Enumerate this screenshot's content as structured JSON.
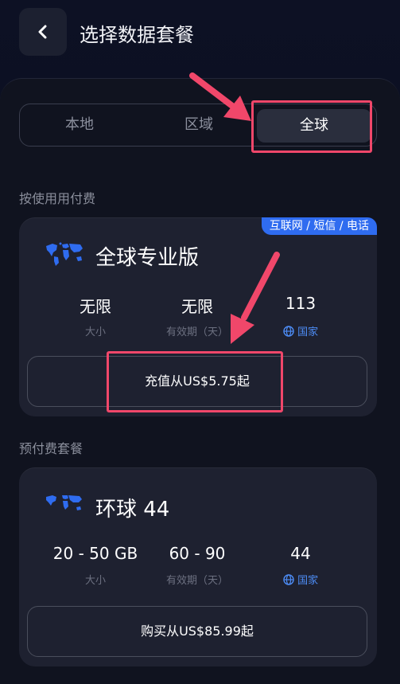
{
  "header": {
    "title": "选择数据套餐"
  },
  "tabs": [
    {
      "label": "本地",
      "active": false
    },
    {
      "label": "区域",
      "active": false
    },
    {
      "label": "全球",
      "active": true
    }
  ],
  "payg": {
    "section_label": "按使用用付费",
    "badge": "互联网 / 短信 / 电话",
    "title": "全球专业版",
    "stats": [
      {
        "value": "无限",
        "label": "大小"
      },
      {
        "value": "无限",
        "label": "有效期（天）"
      },
      {
        "value": "113",
        "label": "国家",
        "icon": "globe-icon"
      }
    ],
    "cta": "充值从US$5.75起"
  },
  "prepaid": {
    "section_label": "预付费套餐",
    "title": "环球 44",
    "stats": [
      {
        "value": "20 - 50 GB",
        "label": "大小"
      },
      {
        "value": "60 - 90",
        "label": "有效期（天）"
      },
      {
        "value": "44",
        "label": "国家",
        "icon": "globe-icon"
      }
    ],
    "cta": "购买从US$85.99起"
  },
  "colors": {
    "accent": "#2f6cf0",
    "highlight": "#f0476a",
    "background": "#0b0f20"
  }
}
